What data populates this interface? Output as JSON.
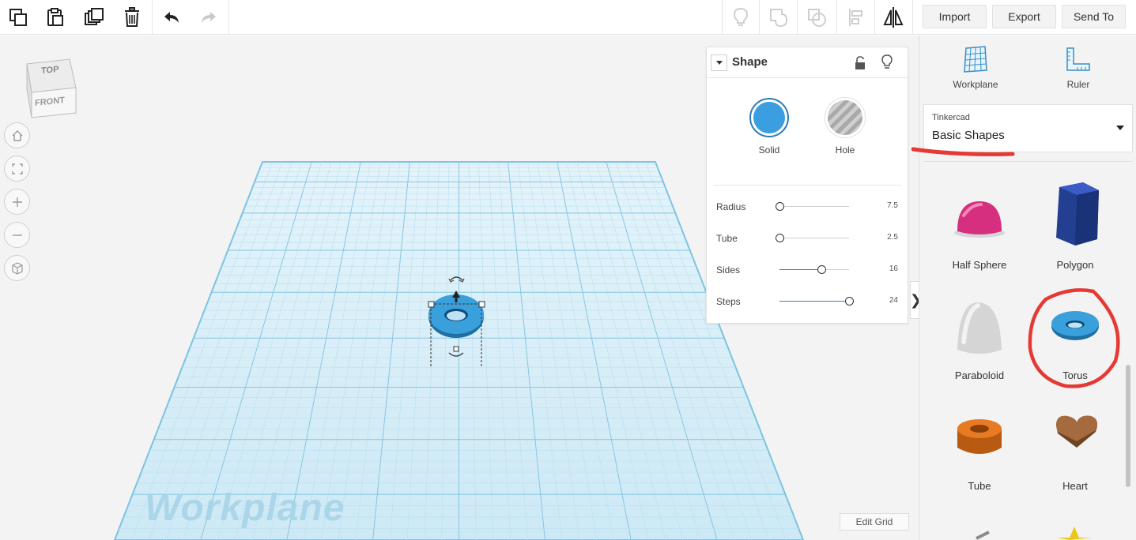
{
  "toolbar": {
    "left_icons": [
      "copy-icon",
      "paste-icon",
      "duplicate-icon",
      "delete-icon",
      "undo-icon",
      "redo-icon"
    ],
    "right_icons": [
      "lightbulb-icon",
      "group-icon",
      "ungroup-icon",
      "align-icon",
      "mirror-icon"
    ],
    "import_label": "Import",
    "export_label": "Export",
    "send_to_label": "Send To"
  },
  "viewcube": {
    "top": "TOP",
    "front": "FRONT"
  },
  "nav_buttons": [
    "home-icon",
    "fit-view-icon",
    "zoom-in-icon",
    "zoom-out-icon",
    "perspective-icon"
  ],
  "workplane": {
    "label": "Workplane",
    "edit_grid_label": "Edit Grid"
  },
  "inspector": {
    "title": "Shape",
    "solid_label": "Solid",
    "hole_label": "Hole",
    "solid_color": "#3a9ee0",
    "props": [
      {
        "label": "Radius",
        "value": "7.5",
        "fraction": 0.0
      },
      {
        "label": "Tube",
        "value": "2.5",
        "fraction": 0.0
      },
      {
        "label": "Sides",
        "value": "16",
        "fraction": 0.6
      },
      {
        "label": "Steps",
        "value": "24",
        "fraction": 1.0
      }
    ]
  },
  "right_panel": {
    "workplane_label": "Workplane",
    "ruler_label": "Ruler",
    "library_small": "Tinkercad",
    "library_name": "Basic Shapes",
    "shapes": [
      "Half Sphere",
      "Polygon",
      "Paraboloid",
      "Torus",
      "Tube",
      "Heart"
    ]
  },
  "colors": {
    "accent": "#3a9ee0",
    "grid": "#9fd3ea",
    "annotation": "#e53935"
  }
}
